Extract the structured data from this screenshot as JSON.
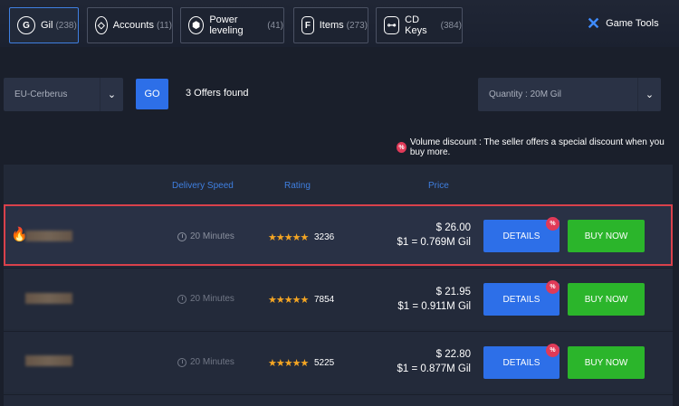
{
  "tabs": [
    {
      "label": "Gil",
      "count": "(238)",
      "icon": "gil-icon",
      "active": true
    },
    {
      "label": "Accounts",
      "count": "(11)",
      "icon": "accounts-icon",
      "active": false
    },
    {
      "label": "Power leveling",
      "count": "(41)",
      "icon": "power-leveling-icon",
      "active": false
    },
    {
      "label": "Items",
      "count": "(273)",
      "icon": "items-icon",
      "active": false
    },
    {
      "label": "CD Keys",
      "count": "(384)",
      "icon": "cd-keys-icon",
      "active": false
    }
  ],
  "game_tools": {
    "label": "Game Tools"
  },
  "filters": {
    "server": "EU-Cerberus",
    "go_label": "GO",
    "offers_found": "3 Offers found",
    "quantity": "Quantity : 20M Gil"
  },
  "discount_note": {
    "icon_text": "%",
    "text": "Volume discount : The seller offers a special discount when you buy more."
  },
  "table": {
    "headers": {
      "delivery": "Delivery Speed",
      "rating": "Rating",
      "price": "Price"
    },
    "rows": [
      {
        "delivery": "20 Minutes",
        "stars": "★★★★★",
        "rating": "3236",
        "price": "$ 26.00",
        "rate": "$1 = 0.769M Gil",
        "details": "DETAILS",
        "buy": "BUY NOW",
        "badge": "%"
      },
      {
        "delivery": "20 Minutes",
        "stars": "★★★★★",
        "rating": "7854",
        "price": "$ 21.95",
        "rate": "$1 = 0.911M Gil",
        "details": "DETAILS",
        "buy": "BUY NOW",
        "badge": "%"
      },
      {
        "delivery": "20 Minutes",
        "stars": "★★★★★",
        "rating": "5225",
        "price": "$ 22.80",
        "rate": "$1 = 0.877M Gil",
        "details": "DETAILS",
        "buy": "BUY NOW",
        "badge": "%"
      }
    ]
  },
  "colors": {
    "accent": "#2d6fe8",
    "buy": "#2bb52b",
    "badge": "#e03a58",
    "highlight_border": "#d9414b"
  }
}
